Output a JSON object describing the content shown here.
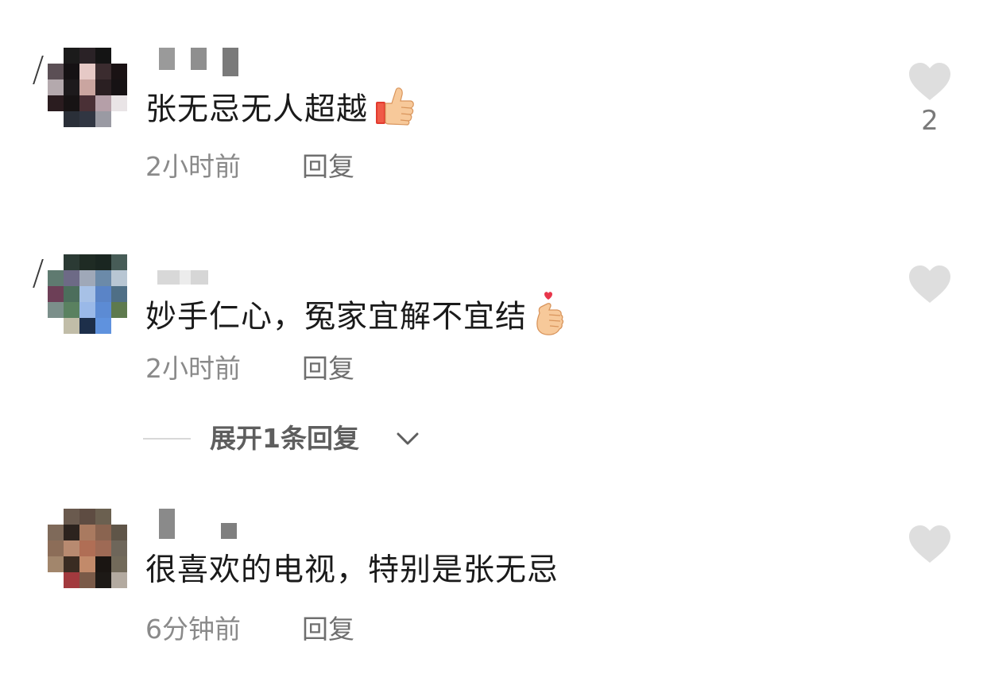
{
  "comments": [
    {
      "text": "张无忌无人超越",
      "emoji": "thumbs-up",
      "time": "2小时前",
      "reply_label": "回复",
      "like_count": "2"
    },
    {
      "text": "妙手仁心，冤家宜解不宜结",
      "emoji": "finger-heart",
      "time": "2小时前",
      "reply_label": "回复",
      "like_count": ""
    },
    {
      "text": "很喜欢的电视，特别是张无忌",
      "emoji": "",
      "time": "6分钟前",
      "reply_label": "回复",
      "like_count": ""
    }
  ],
  "expand_replies": {
    "label": "展开1条回复",
    "icon": "chevron-down-icon"
  },
  "colors": {
    "like_heart": "#dedede",
    "text": "#1a1a1a",
    "meta": "#8a8a8a"
  }
}
